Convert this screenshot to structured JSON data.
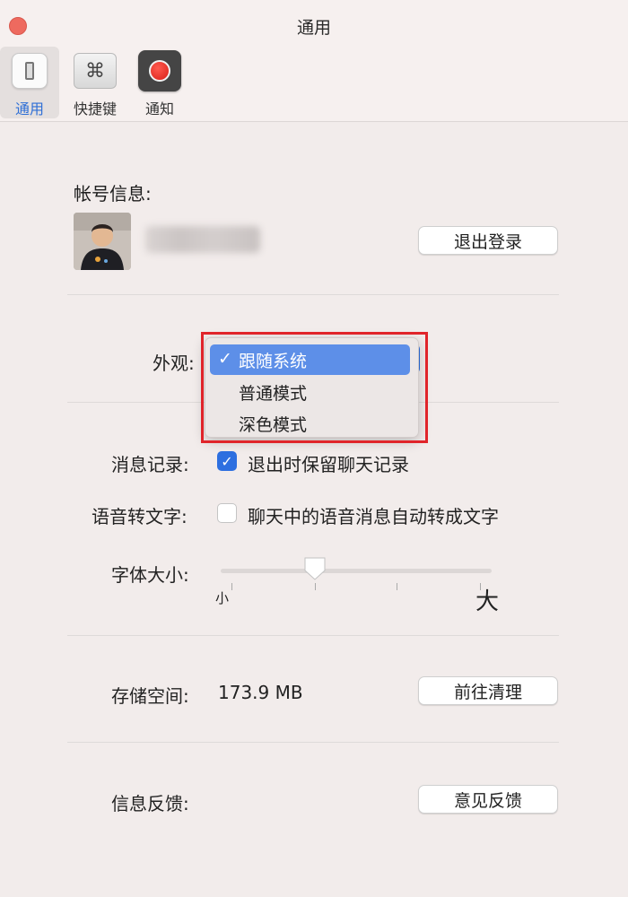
{
  "window": {
    "title": "通用"
  },
  "toolbar": {
    "tabs": [
      {
        "label": "通用",
        "icon": "general-switch-icon",
        "selected": true
      },
      {
        "label": "快捷键",
        "icon": "command-key-icon",
        "selected": false
      },
      {
        "label": "通知",
        "icon": "notification-record-icon",
        "selected": false
      }
    ],
    "shortcut_glyph": "⌘"
  },
  "account": {
    "section_title": "帐号信息:",
    "logout_label": "退出登录"
  },
  "appearance": {
    "label": "外观:",
    "options": [
      "跟随系统",
      "普通模式",
      "深色模式"
    ],
    "selected_index": 0,
    "check_mark": "✓"
  },
  "messages": {
    "label": "消息记录:",
    "checkbox_label": "退出时保留聊天记录",
    "checked": true
  },
  "voice": {
    "label": "语音转文字:",
    "checkbox_label": "聊天中的语音消息自动转成文字",
    "checked": false
  },
  "font_size": {
    "label": "字体大小:",
    "min_label": "小",
    "max_label": "大",
    "level": 2,
    "levels": 4
  },
  "storage": {
    "label": "存储空间:",
    "value": "173.9 MB",
    "clean_label": "前往清理"
  },
  "feedback": {
    "label": "信息反馈:",
    "button_label": "意见反馈"
  },
  "colors": {
    "accent": "#2d6fe0",
    "highlight_box": "#e0242a",
    "close": "#ee6a5f"
  }
}
